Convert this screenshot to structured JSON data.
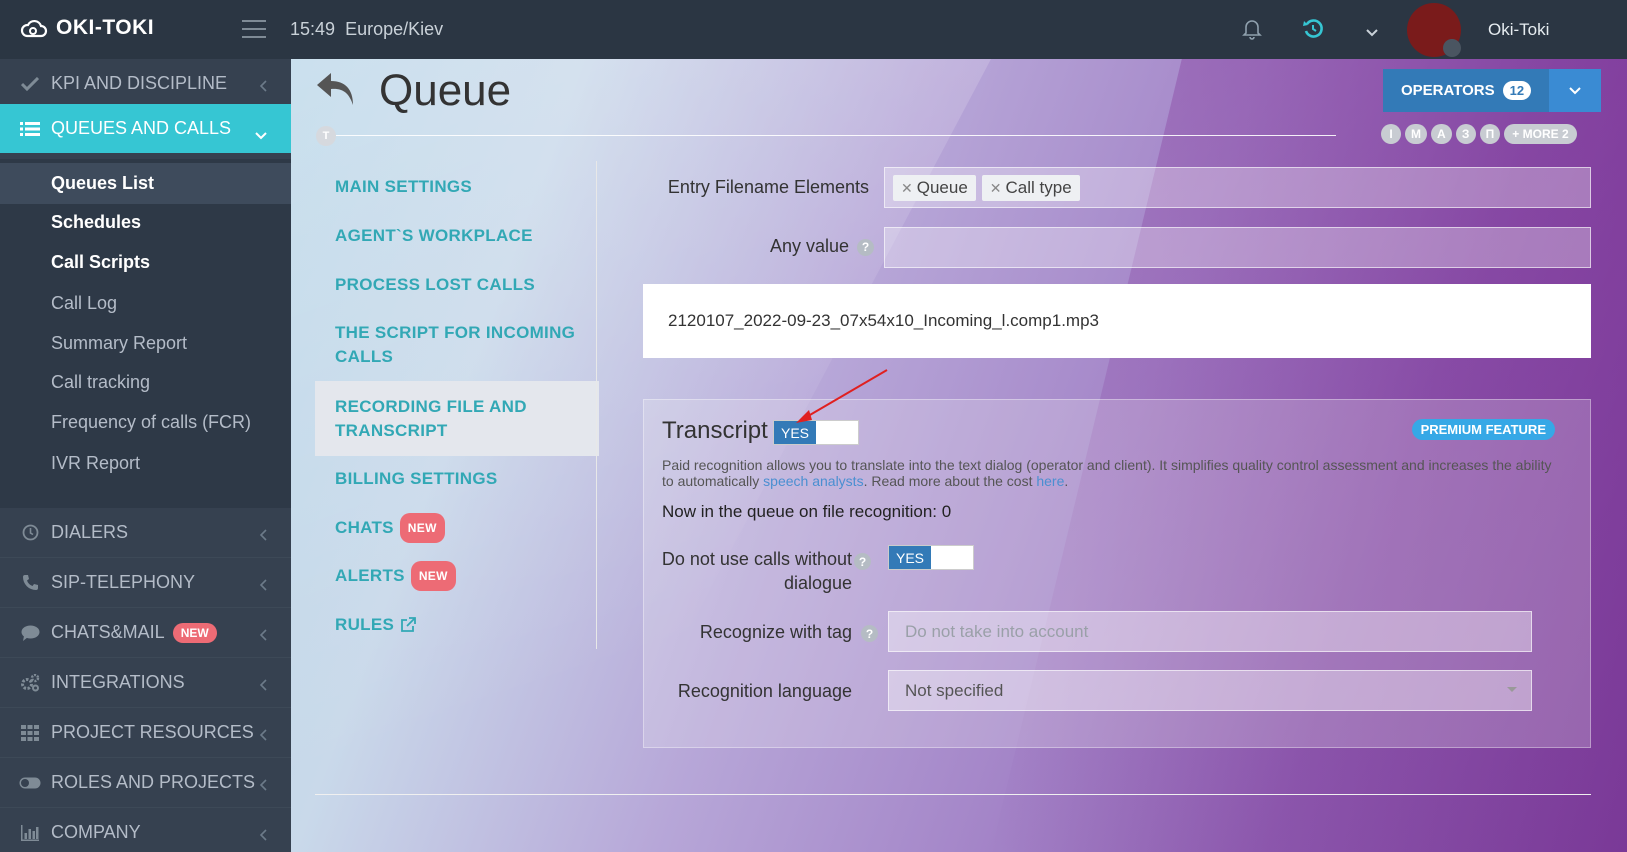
{
  "header": {
    "logo_text": "OKI-TOKI",
    "time": "15:49",
    "timezone": "Europe/Kiev",
    "username": "Oki-Toki"
  },
  "sidebar": {
    "items": [
      {
        "label": "KPI AND DISCIPLINE",
        "icon": "check-icon"
      },
      {
        "label": "QUEUES AND CALLS",
        "icon": "list-icon",
        "active": true
      },
      {
        "label": "DIALERS",
        "icon": "clock-icon"
      },
      {
        "label": "SIP-TELEPHONY",
        "icon": "phone-icon"
      },
      {
        "label": "CHATS&MAIL",
        "icon": "chat-icon",
        "badge": "NEW"
      },
      {
        "label": "INTEGRATIONS",
        "icon": "gears-icon"
      },
      {
        "label": "PROJECT RESOURCES",
        "icon": "grid-icon"
      },
      {
        "label": "ROLES AND PROJECTS",
        "icon": "toggle-icon"
      },
      {
        "label": "COMPANY",
        "icon": "bar-chart-icon"
      }
    ],
    "subitems": [
      "Queues List",
      "Schedules",
      "Call Scripts",
      "Call Log",
      "Summary Report",
      "Call tracking",
      "Frequency of calls (FCR)",
      "IVR Report"
    ]
  },
  "page": {
    "title": "Queue",
    "timeline_start": "T",
    "timeline_tags": [
      "І",
      "М",
      "А",
      "З",
      "П",
      "+ MORE 2"
    ],
    "operators_label": "OPERATORS",
    "operators_count": "12"
  },
  "tabs": [
    {
      "label": "MAIN SETTINGS"
    },
    {
      "label": "AGENT`S WORKPLACE"
    },
    {
      "label": "PROCESS LOST CALLS"
    },
    {
      "label": "THE SCRIPT FOR INCOMING CALLS"
    },
    {
      "label": "RECORDING FILE AND TRANSCRIPT",
      "active": true
    },
    {
      "label": "BILLING SETTINGS"
    },
    {
      "label": "CHATS",
      "badge": "NEW"
    },
    {
      "label": "ALERTS",
      "badge": "NEW"
    },
    {
      "label": "RULES"
    }
  ],
  "form": {
    "entry_label": "Entry Filename Elements",
    "chips": [
      "Queue",
      "Call type"
    ],
    "any_value_label": "Any value",
    "help_glyph": "?",
    "filename": "2120107_2022-09-23_07x54x10_Incoming_l.comp1.mp3"
  },
  "transcript": {
    "title": "Transcript",
    "toggle_label": "YES",
    "premium": "PREMIUM FEATURE",
    "desc_part1": "Paid recognition allows you to translate into the text dialog (operator and client). It simplifies quality control assessment and increases the ability to automatically ",
    "desc_link1": "speech analysts",
    "desc_part2": ". Read more about the cost ",
    "desc_link2": "here",
    "desc_part3": ".",
    "queue_line": "Now in the queue on file recognition: 0",
    "no_dialogue_label_1": "Do not use calls without",
    "no_dialogue_label_2": "dialogue",
    "no_dialogue_toggle": "YES",
    "tag_label": "Recognize with tag",
    "tag_placeholder": "Do not take into account",
    "lang_label": "Recognition language",
    "lang_value": "Not specified"
  },
  "colors": {
    "sidebar_active": "#36c6d3",
    "tab_text": "#32a8b5",
    "primary": "#337ab7",
    "badge_new": "#ed6b75",
    "premium": "#36a8e6"
  }
}
